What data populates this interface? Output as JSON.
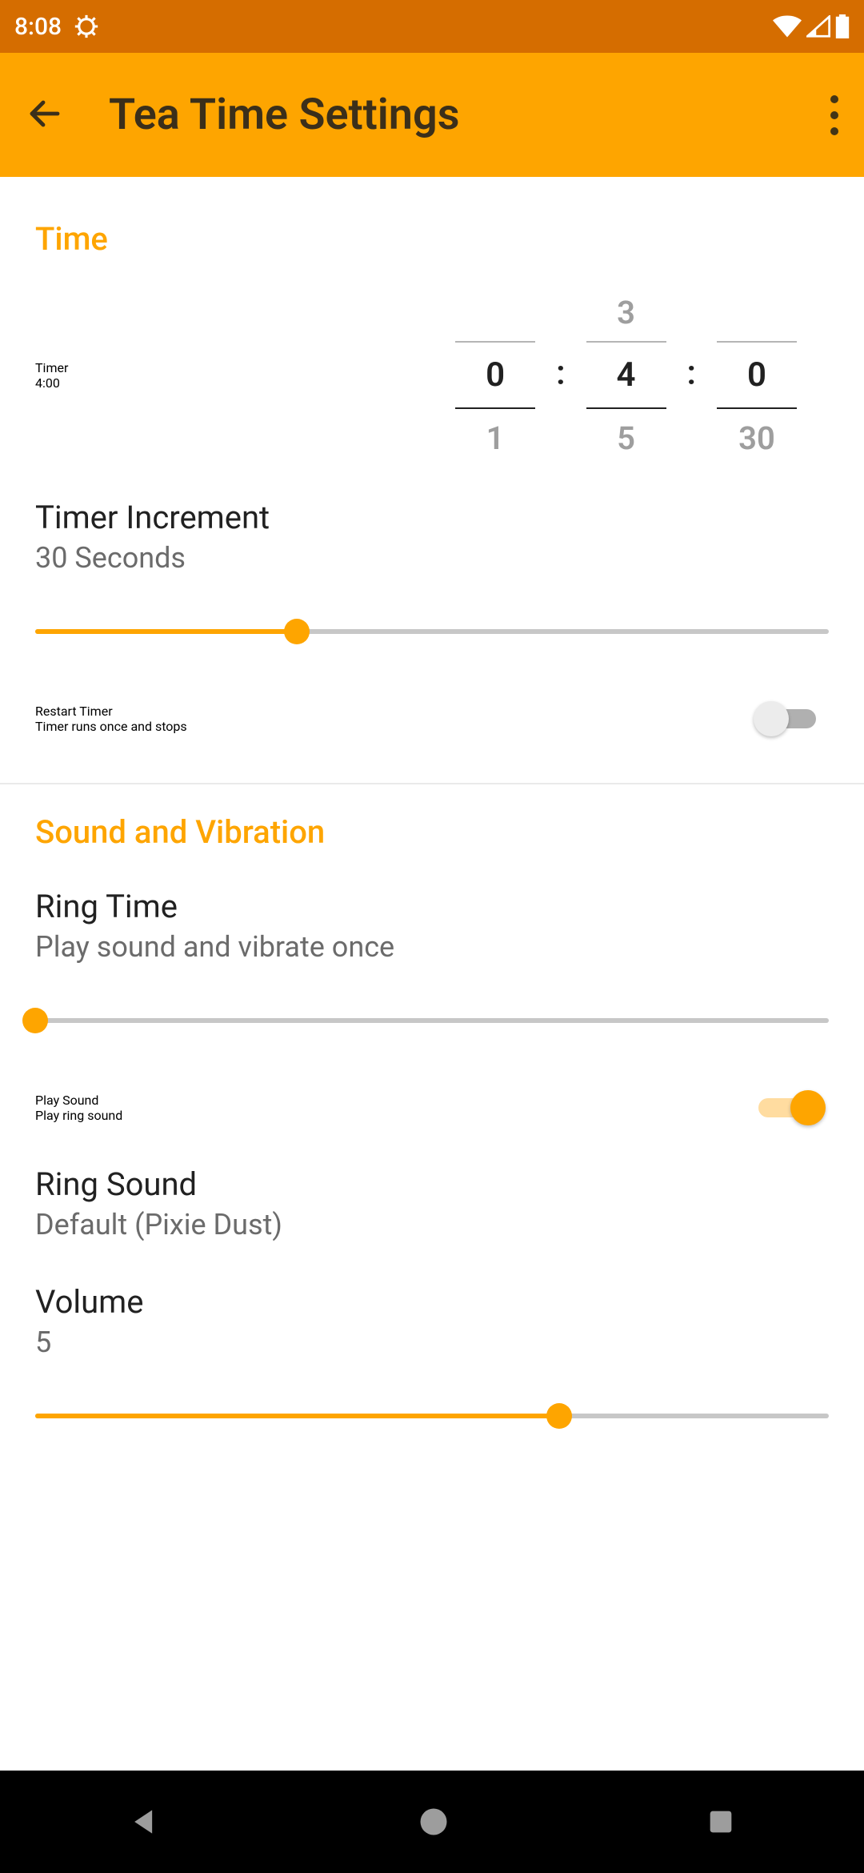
{
  "status": {
    "time": "8:08"
  },
  "appbar": {
    "title": "Tea Time Settings"
  },
  "sections": {
    "time_header": "Time",
    "sound_header": "Sound and Vibration"
  },
  "timer": {
    "label": "Timer",
    "value_text": "4:00",
    "picker": {
      "hours": {
        "prev": "",
        "sel": "0",
        "next": "1"
      },
      "minutes": {
        "prev": "3",
        "sel": "4",
        "next": "5"
      },
      "seconds": {
        "prev": "",
        "sel": "0",
        "next": "30"
      }
    }
  },
  "increment": {
    "label": "Timer Increment",
    "value_text": "30 Seconds",
    "slider_pct": 33
  },
  "restart": {
    "label": "Restart Timer",
    "sub": "Timer runs once and stops",
    "on": false
  },
  "ring_time": {
    "label": "Ring Time",
    "sub": "Play sound and vibrate once",
    "slider_pct": 0
  },
  "play_sound": {
    "label": "Play Sound",
    "sub": "Play ring sound",
    "on": true
  },
  "ring_sound": {
    "label": "Ring Sound",
    "sub": "Default (Pixie Dust)"
  },
  "volume": {
    "label": "Volume",
    "value_text": "5",
    "slider_pct": 66
  },
  "colors": {
    "accent": "#fea500"
  }
}
